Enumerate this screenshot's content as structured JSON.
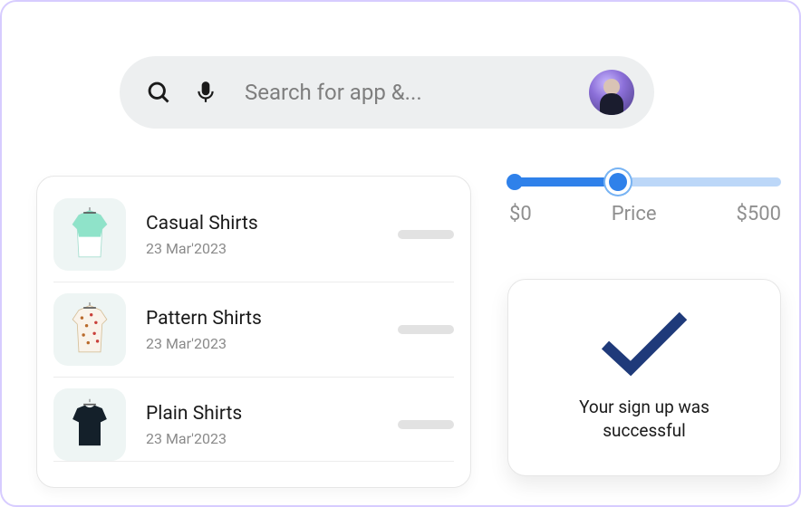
{
  "search": {
    "placeholder": "Search for app &..."
  },
  "list": {
    "items": [
      {
        "title": "Casual Shirts",
        "date": "23 Mar'2023"
      },
      {
        "title": "Pattern Shirts",
        "date": "23 Mar'2023"
      },
      {
        "title": "Plain Shirts",
        "date": "23 Mar'2023"
      }
    ]
  },
  "slider": {
    "min_label": "$0",
    "label": "Price",
    "max_label": "$500"
  },
  "success": {
    "message": "Your sign up was successful"
  }
}
